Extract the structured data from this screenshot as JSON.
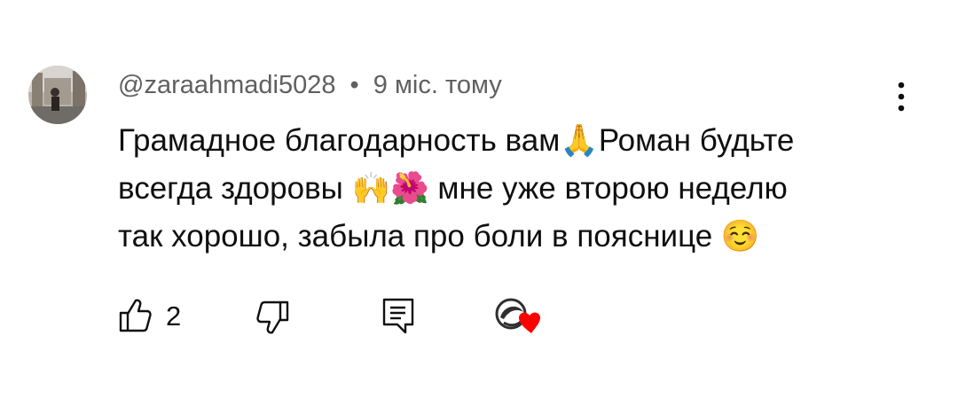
{
  "comment": {
    "author": "@zaraahmadi5028",
    "separator": "•",
    "timestamp": "9 міс. тому",
    "text": "Грамадное благодарность вам🙏Роман будьте\nвсегда здоровы 🙌🌺 мне уже второю неделю\nтак хорошо, забыла про боли в пояснице ☺️"
  },
  "actions": {
    "like_count": "2"
  },
  "icons": {
    "like": "thumb-up-icon",
    "dislike": "thumb-down-icon",
    "reply": "comment-reply-icon",
    "creator_heart": "creator-heart-icon",
    "menu": "more-vertical-icon"
  },
  "colors": {
    "text": "#0f0f0f",
    "meta": "#606060",
    "heart": "#ff0000"
  }
}
